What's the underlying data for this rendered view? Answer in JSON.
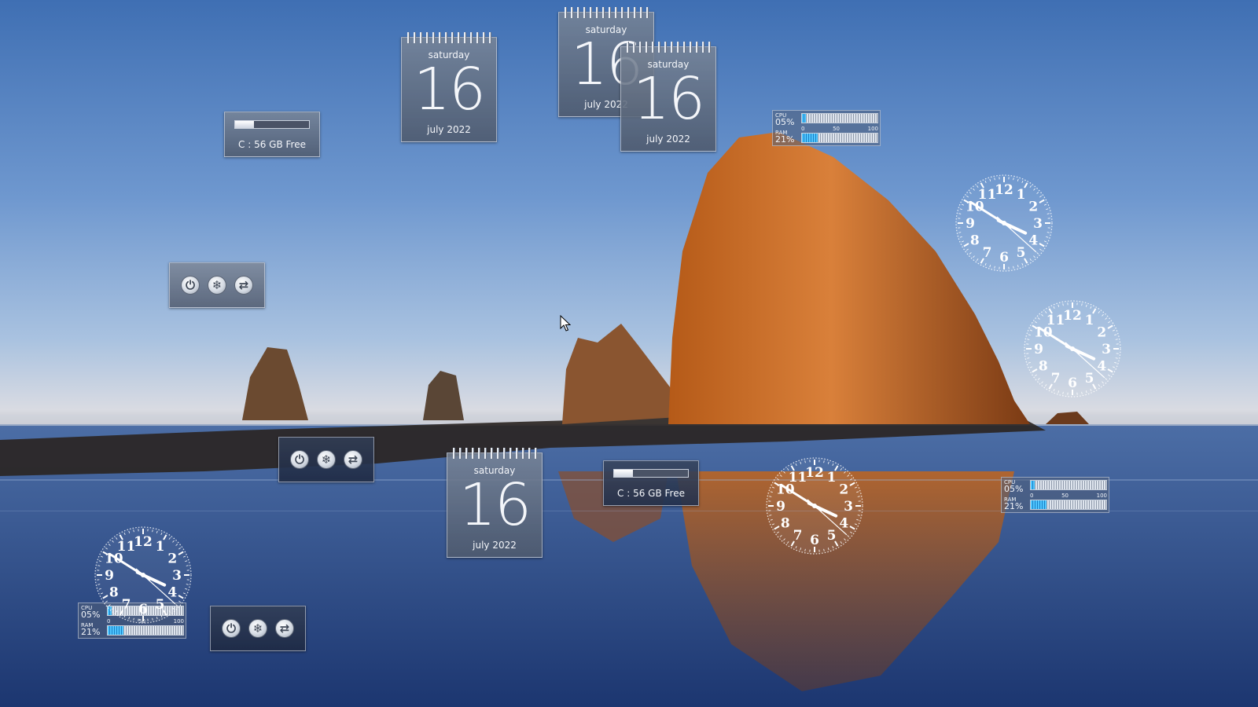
{
  "calendar": {
    "weekday": "saturday",
    "day": "16",
    "month_year": "july 2022"
  },
  "drive": {
    "label": "C : 56 GB Free",
    "used_fraction": 0.25
  },
  "meter": {
    "cpu_label": "CPU",
    "cpu_value": "05%",
    "cpu_fraction": 0.05,
    "ram_label": "RAM",
    "ram_value": "21%",
    "ram_fraction": 0.21,
    "scale": [
      "0",
      "50",
      "100"
    ]
  },
  "power": {
    "buttons": [
      "power-icon",
      "sleep-icon",
      "switch-user-icon"
    ]
  },
  "clock": {
    "numerals": [
      "12",
      "1",
      "2",
      "3",
      "4",
      "5",
      "6",
      "7",
      "8",
      "9",
      "10",
      "11"
    ],
    "hour": 3,
    "minute": 50,
    "second": 22
  },
  "colors": {
    "gadget_glass": "#7a8698",
    "meter_fill": "#2fa8f0",
    "sky": "#6f98cf",
    "rock": "#c4651f",
    "sea": "#25427a"
  }
}
